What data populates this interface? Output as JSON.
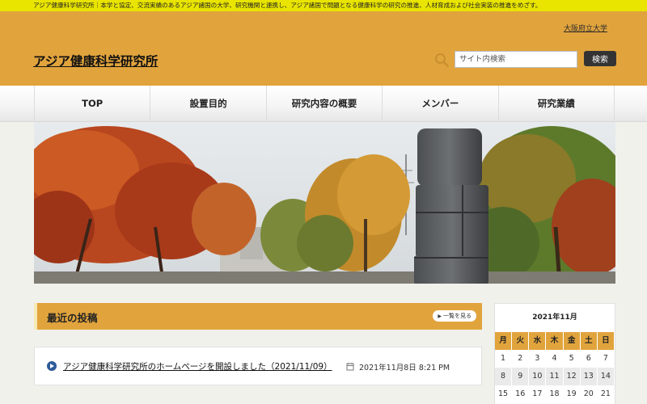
{
  "topbar": {
    "text": "アジア健康科学研究所｜本学と協定、交流実績のあるアジア諸国の大学、研究機関と連携し、アジア諸国で問題となる健康科学の研究の推進、人材育成および社会実装の推進をめざす。"
  },
  "header": {
    "university_link": "大阪府立大学",
    "site_title": "アジア健康科学研究所",
    "search_placeholder": "サイト内検索",
    "search_button": "検索"
  },
  "nav": {
    "items": [
      "TOP",
      "設置目的",
      "研究内容の概要",
      "メンバー",
      "研究業績"
    ]
  },
  "posts": {
    "heading": "最近の投稿",
    "list_button": "一覧を見る",
    "items": [
      {
        "title": "アジア健康科学研究所のホームページを開設しました（2021/11/09）",
        "date": "2021年11月8日 8:21 PM"
      }
    ]
  },
  "calendar": {
    "title": "2021年11月",
    "weekdays": [
      "月",
      "火",
      "水",
      "木",
      "金",
      "土",
      "日"
    ],
    "weeks": [
      [
        "1",
        "2",
        "3",
        "4",
        "5",
        "6",
        "7"
      ],
      [
        "8",
        "9",
        "10",
        "11",
        "12",
        "13",
        "14"
      ],
      [
        "15",
        "16",
        "17",
        "18",
        "19",
        "20",
        "21"
      ]
    ]
  },
  "colors": {
    "accent": "#e1a43d",
    "topbar": "#e9e400",
    "nav_bg": "#f4f4f4",
    "search_button": "#333333"
  },
  "icons": {
    "search": "search-icon",
    "post_bullet": "play-circle-icon",
    "date": "calendar-icon"
  }
}
